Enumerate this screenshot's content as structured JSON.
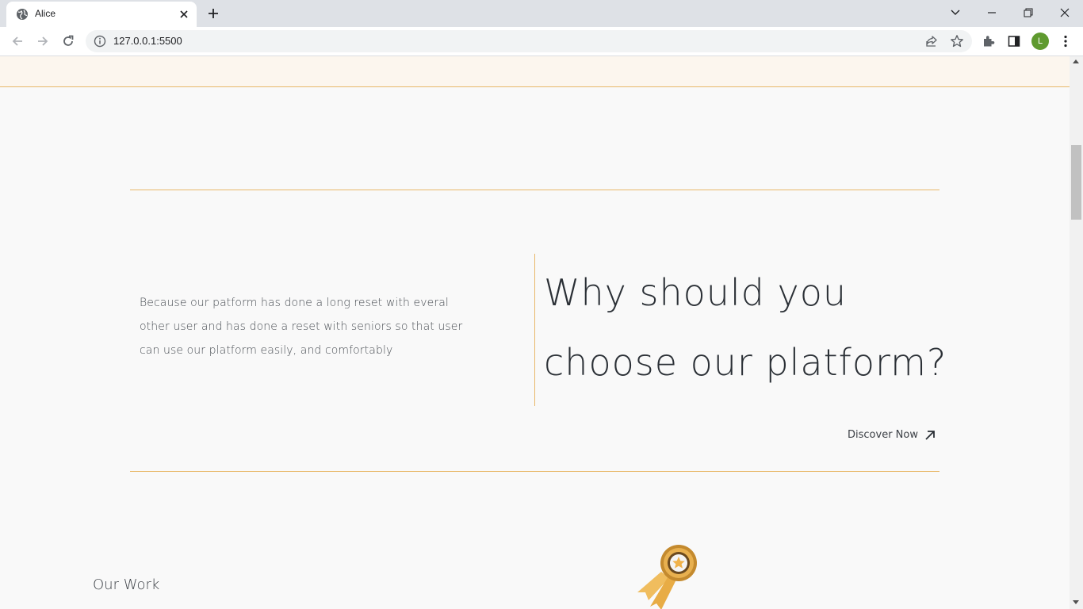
{
  "browser": {
    "tab_title": "Alice",
    "url": "127.0.0.1:5500",
    "profile_initial": "L",
    "icons": [
      "globe-icon",
      "close-icon",
      "plus-icon",
      "chevron-down-icon",
      "minimize-icon",
      "restore-icon",
      "close-window-icon",
      "back-icon",
      "forward-icon",
      "reload-icon",
      "info-icon",
      "share-icon",
      "star-icon",
      "extensions-icon",
      "side-panel-icon",
      "menu-icon"
    ]
  },
  "section": {
    "description": "Because our patform has done a long reset with everal other user and has done a reset with seniors so that user can use our platform easily, and comfortably",
    "heading_line1": "Why should you",
    "heading_line2": "choose our platform?",
    "cta_label": "Discover Now",
    "cta_icon": "arrow-up-right-icon"
  },
  "work": {
    "title": "Our Work",
    "badge_icon": "award-ribbon-icon"
  },
  "colors": {
    "accent": "#e8b86a",
    "background": "#f9f9f9",
    "band": "#fcf6ee",
    "text": "#2b3036"
  }
}
